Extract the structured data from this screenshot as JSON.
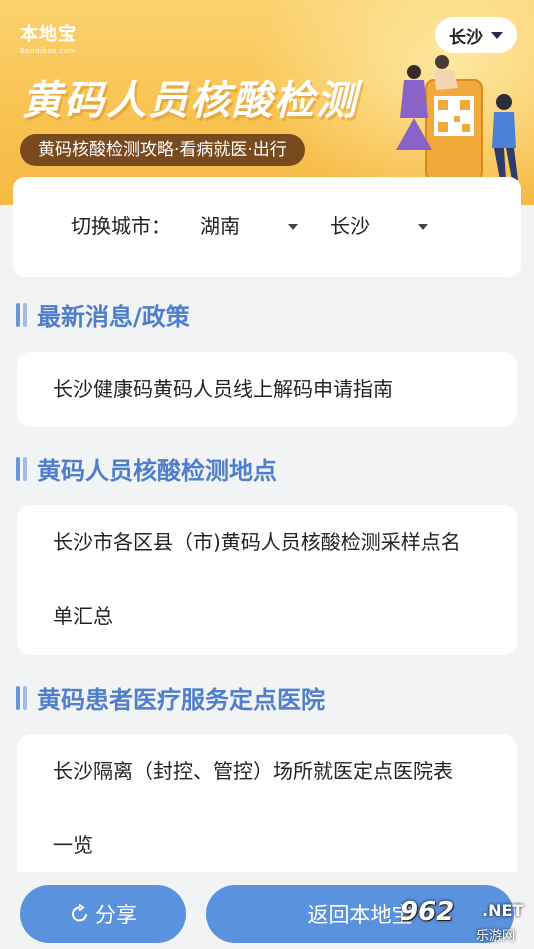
{
  "banner": {
    "logo_text": "本地宝",
    "logo_sub": "Bendibao.com",
    "city_pill": "长沙",
    "title": "黄码人员核酸检测",
    "subtitle": "黄码核酸检测攻略·看病就医·出行",
    "brand_color": "#f8c352"
  },
  "city_switch": {
    "label": "切换城市：",
    "province": "湖南",
    "city": "长沙"
  },
  "sections": [
    {
      "title": "最新消息/政策",
      "link": "长沙健康码黄码人员线上解码申请指南"
    },
    {
      "title": "黄码人员核酸检测地点",
      "link_line1": "长沙市各区县（市)黄码人员核酸检测采样点名",
      "link_line2": "单汇总"
    },
    {
      "title": "黄码患者医疗服务定点医院",
      "link_line1": "长沙隔离（封控、管控）场所就医定点医院表",
      "link_line2": "一览"
    }
  ],
  "bottom": {
    "share": "分享",
    "back": "返回本地宝",
    "accent": "#5b92dd"
  },
  "watermark": {
    "num": "962",
    "net": ".NET",
    "cn": "乐游网"
  }
}
